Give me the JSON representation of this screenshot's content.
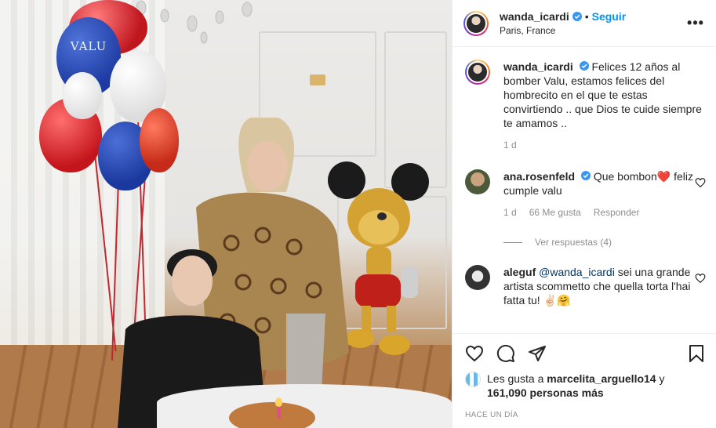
{
  "post": {
    "username": "wanda_icardi",
    "follow_label": "Seguir",
    "separator": "•",
    "location": "Paris, France",
    "more_label": "•••",
    "balloon_text": "VALU",
    "caption": "Felices 12 años al bomber Valu, estamos felices del hombrecito en el que te estas convirtiendo .. que Dios te cuide siempre te amamos ..",
    "caption_age": "1 d"
  },
  "comments": [
    {
      "username": "ana.rosenfeld",
      "verified": true,
      "text": "Que bombon❤️ feliz cumple valu",
      "age": "1 d",
      "likes": "66 Me gusta",
      "reply_label": "Responder",
      "view_replies": "Ver respuestas (4)"
    },
    {
      "username": "aleguf",
      "mention": "@wanda_icardi",
      "text": " sei una grande artista scommetto che quella torta l'hai fatta tu! ✌🏻🤗"
    }
  ],
  "likes": {
    "prefix": "Les gusta a ",
    "first_user": "marcelita_arguello14",
    "conjunction": " y ",
    "others": "161,090 personas más"
  },
  "timestamp": "Hace un día",
  "colors": {
    "accent": "#0095f6",
    "text": "#262626",
    "muted": "#8e8e8e",
    "border": "#efefef",
    "verified": "#3897f0"
  },
  "icons": [
    "heart-icon",
    "comment-icon",
    "share-icon",
    "bookmark-icon",
    "verified-badge-icon",
    "more-options-icon"
  ]
}
